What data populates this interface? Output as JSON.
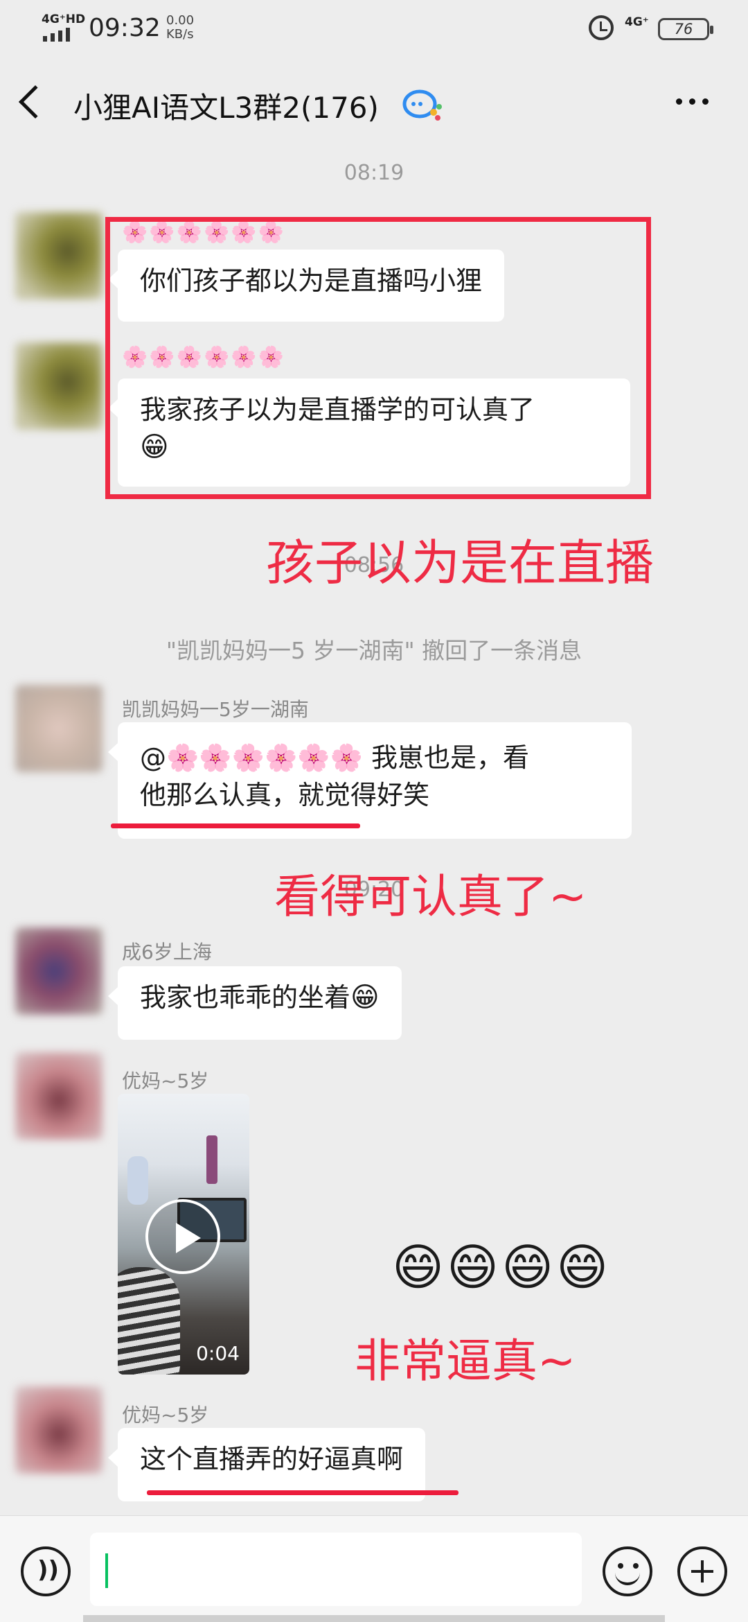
{
  "status_bar": {
    "network": "4G⁺HD",
    "time": "09:32",
    "speed_value": "0.00",
    "speed_unit": "KB/s",
    "network_right": "4G⁺",
    "battery": "76"
  },
  "header": {
    "title": "小狸AI语文L3群2(176)"
  },
  "chat": {
    "timestamp_1": "08:19",
    "msg1": {
      "flowers": "🌸🌸🌸🌸🌸🌸",
      "text": "你们孩子都以为是直播吗小狸"
    },
    "msg2": {
      "flowers": "🌸🌸🌸🌸🌸🌸",
      "text": "我家孩子以为是直播学的可认真了",
      "emoji": "😁"
    },
    "timestamp_2": "08:56",
    "recall_notice": "\"凯凯妈妈一5 岁一湖南\" 撤回了一条消息",
    "msg3": {
      "sender": "凯凯妈妈一5岁一湖南",
      "mention": "@🌸🌸🌸🌸🌸🌸",
      "text_a": " 我崽也是，看",
      "text_b": "他那么认真，就觉得好笑"
    },
    "timestamp_3": "09:20",
    "msg4": {
      "sender": "成6岁上海",
      "text": "我家也乖乖的坐着",
      "emoji": "😁"
    },
    "msg5": {
      "sender": "优妈~5岁",
      "video_duration": "0:04"
    },
    "msg6": {
      "sender": "优妈~5岁",
      "text": "这个直播弄的好逼真啊"
    }
  },
  "annotations": {
    "note1": "孩子以为是在直播",
    "note2": "看得可认真了~",
    "note3": "非常逼真~",
    "emojis": "😄😄😄😄",
    "color": "#ee2b44"
  }
}
